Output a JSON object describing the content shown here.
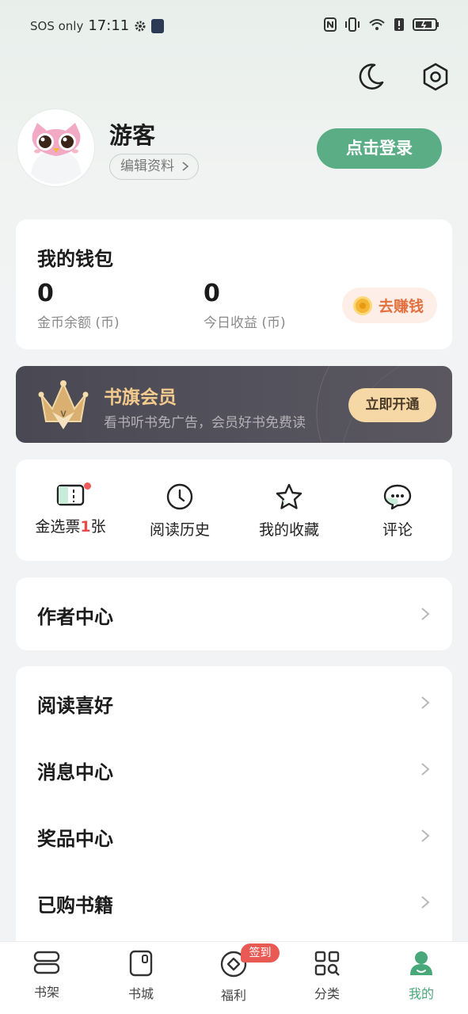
{
  "status_bar": {
    "carrier": "SOS only",
    "time": "17:11"
  },
  "profile": {
    "username": "游客",
    "edit_label": "编辑资料",
    "login_label": "点击登录"
  },
  "wallet": {
    "title": "我的钱包",
    "coins_value": "0",
    "coins_label": "金币余额 (币)",
    "today_value": "0",
    "today_label": "今日收益 (币)",
    "earn_label": "去赚钱"
  },
  "vip": {
    "title": "书旗会员",
    "subtitle": "看书听书免广告，会员好书免费读",
    "button": "立即开通"
  },
  "quick_actions": {
    "vote_prefix": "金选票",
    "vote_count": "1",
    "vote_suffix": "张",
    "history": "阅读历史",
    "favorites": "我的收藏",
    "comments": "评论"
  },
  "author_center": "作者中心",
  "menu_items": [
    "阅读喜好",
    "消息中心",
    "奖品中心",
    "已购书籍"
  ],
  "bottom_nav": {
    "items": [
      "书架",
      "书城",
      "福利",
      "分类",
      "我的"
    ],
    "active": "我的",
    "sign_badge": "签到"
  },
  "colors": {
    "accent": "#5aad84",
    "nav_active": "#49a87a",
    "vip_gold": "#f3c98d",
    "earn_orange": "#e2713f",
    "badge_red": "#ea5a55"
  }
}
